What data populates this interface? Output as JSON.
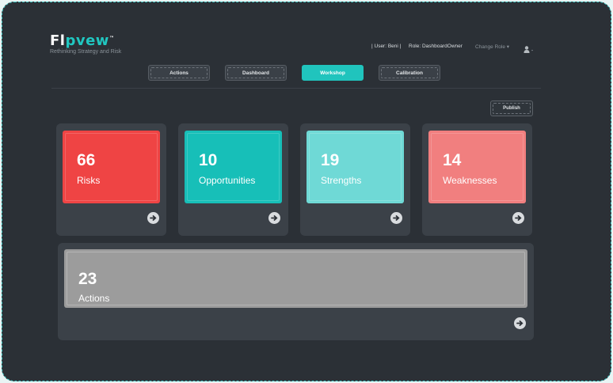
{
  "brand": {
    "logo_prefix": "Fl",
    "logo_accent": "pvew",
    "logo_tm": "™",
    "tagline": "Rethinking Strategy and Risk"
  },
  "user_bar": {
    "user": "| User: Beni |",
    "role": "Role: DashboardOwner",
    "change_role": "Change Role",
    "change_role_icon": "chevron-down-icon",
    "user_icon": "user-icon"
  },
  "tabs": [
    {
      "label": "Actions",
      "active": false
    },
    {
      "label": "Dashboard",
      "active": false
    },
    {
      "label": "Workshop",
      "active": true
    },
    {
      "label": "Calibration",
      "active": false
    }
  ],
  "publish_label": "Publish",
  "cards": [
    {
      "count": "66",
      "label": "Risks",
      "color": "#ef4444"
    },
    {
      "count": "10",
      "label": "Opportunities",
      "color": "#17bfb8"
    },
    {
      "count": "19",
      "label": "Strengths",
      "color": "#6fd9d6"
    },
    {
      "count": "14",
      "label": "Weaknesses",
      "color": "#f17f7f"
    }
  ],
  "actions_card": {
    "count": "23",
    "label": "Actions",
    "color": "#9c9c9c"
  },
  "colors": {
    "background": "#2b3036",
    "panel": "#3b4148",
    "accent": "#20c4bd"
  }
}
